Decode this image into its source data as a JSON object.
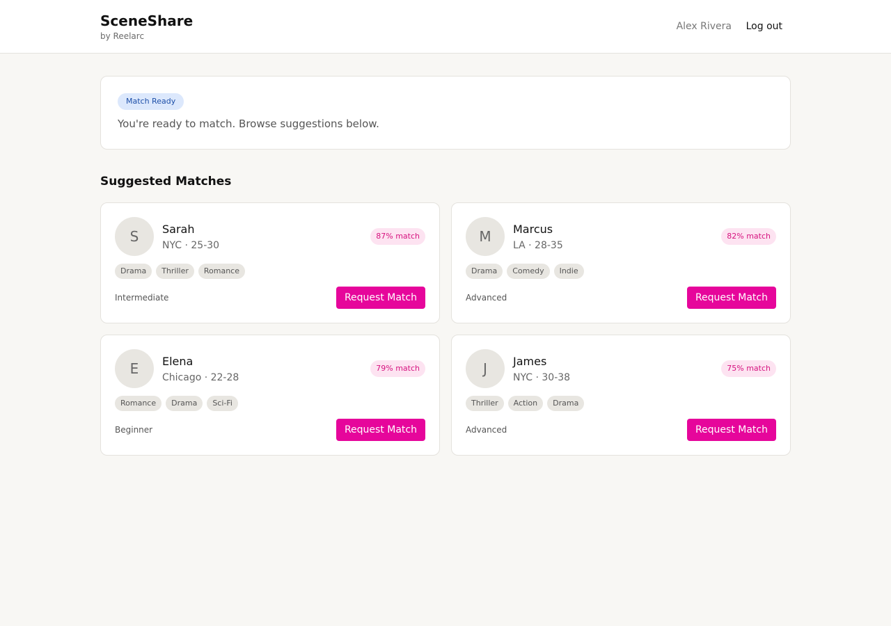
{
  "header": {
    "brand": "SceneShare",
    "brand_sub": "by Reelarc",
    "user_name": "Alex Rivera",
    "logout_label": "Log out"
  },
  "status": {
    "badge": "Match Ready",
    "message": "You're ready to match. Browse suggestions below."
  },
  "section_title": "Suggested Matches",
  "matches": [
    {
      "initial": "S",
      "name": "Sarah",
      "meta": "NYC · 25-30",
      "match": "87% match",
      "tags": [
        "Drama",
        "Thriller",
        "Romance"
      ],
      "level": "Intermediate",
      "button": "Request Match"
    },
    {
      "initial": "M",
      "name": "Marcus",
      "meta": "LA · 28-35",
      "match": "82% match",
      "tags": [
        "Drama",
        "Comedy",
        "Indie"
      ],
      "level": "Advanced",
      "button": "Request Match"
    },
    {
      "initial": "E",
      "name": "Elena",
      "meta": "Chicago · 22-28",
      "match": "79% match",
      "tags": [
        "Romance",
        "Drama",
        "Sci-Fi"
      ],
      "level": "Beginner",
      "button": "Request Match"
    },
    {
      "initial": "J",
      "name": "James",
      "meta": "NYC · 30-38",
      "match": "75% match",
      "tags": [
        "Thriller",
        "Action",
        "Drama"
      ],
      "level": "Advanced",
      "button": "Request Match"
    }
  ],
  "colors": {
    "accent": "#e6069b",
    "page_bg": "#f8f7f4",
    "status_badge_bg": "#dce8fc",
    "match_badge_bg": "#fde3f1"
  }
}
